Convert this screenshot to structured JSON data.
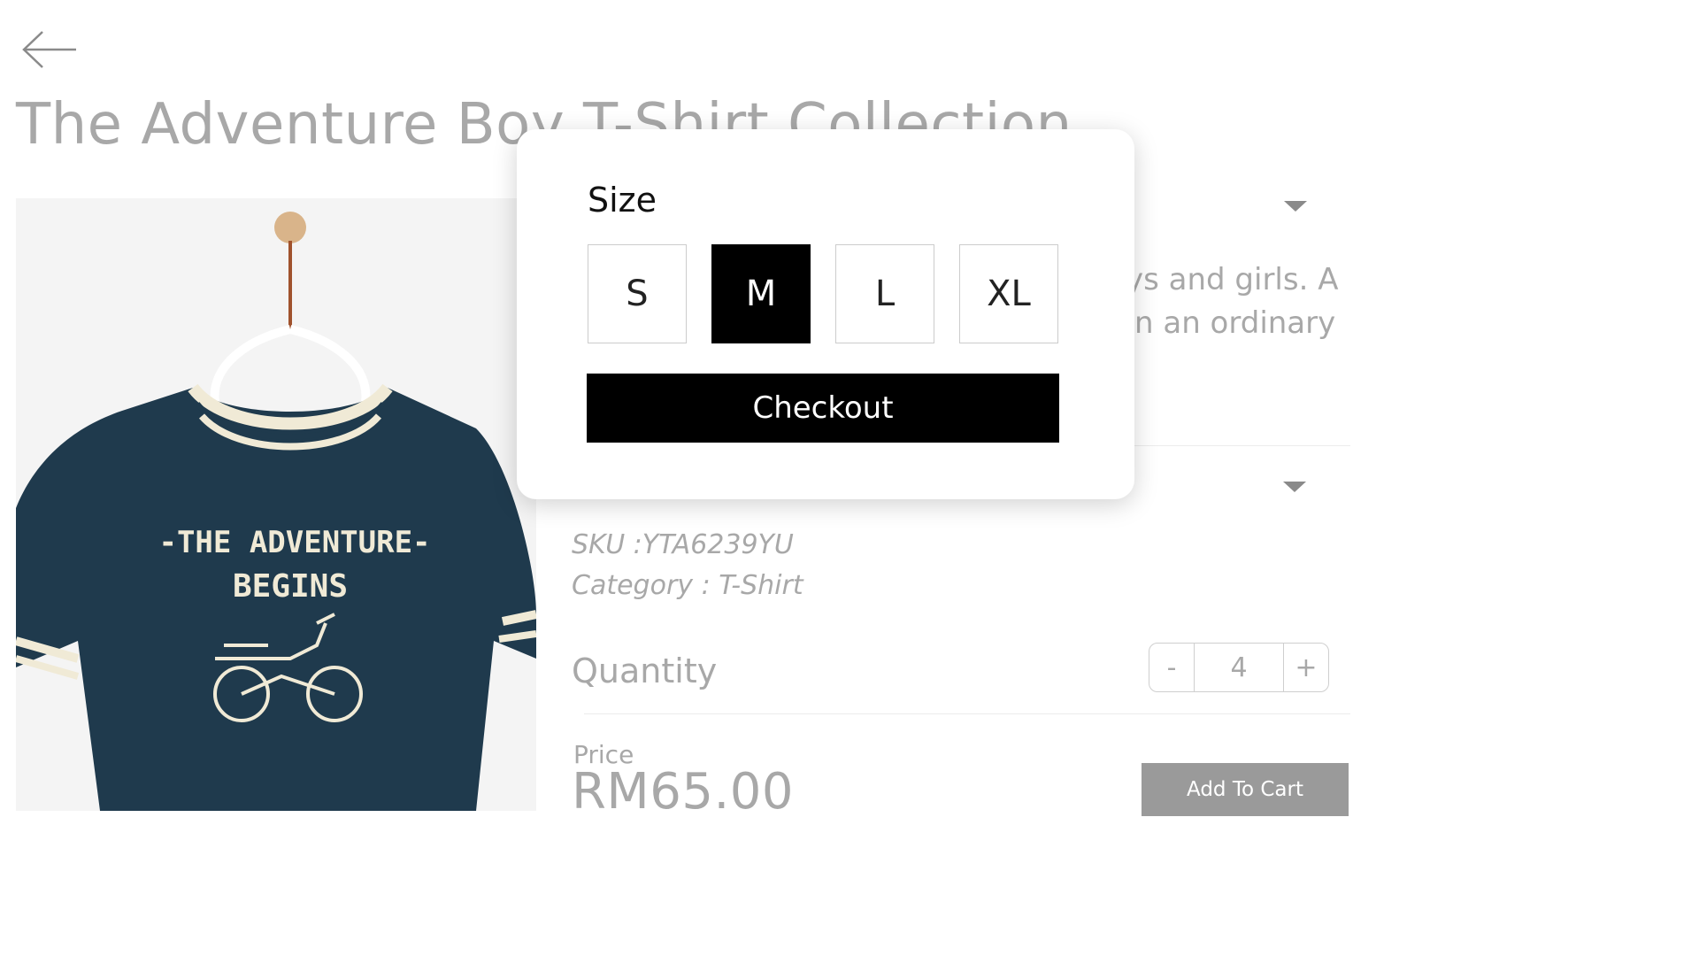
{
  "header": {
    "title": "The Adventure Boy T-Shirt Collection"
  },
  "product": {
    "image_alt": "Navy t-shirt with The Adventure Begins print",
    "print_text_line1": "-THE ADVENTURE-",
    "print_text_line2": "BEGINS",
    "description_line1_fragment": "ys and girls. A",
    "description_line2_fragment": "n an ordinary",
    "sku": "SKU :YTA6239YU",
    "category": "Category : T-Shirt"
  },
  "quantity": {
    "label": "Quantity",
    "minus": "-",
    "value": "4",
    "plus": "+"
  },
  "price": {
    "label": "Price",
    "value": "RM65.00"
  },
  "add_to_cart_label": "Add To Cart",
  "size_popup": {
    "title": "Size",
    "options": [
      "S",
      "M",
      "L",
      "XL"
    ],
    "selected": "M",
    "checkout_label": "Checkout"
  },
  "icons": {
    "back": "arrow-left-icon",
    "dropdown": "caret-down-icon"
  },
  "colors": {
    "shirt": "#1f3a4d",
    "trim": "#f0ead6",
    "muted_text": "#a8a8a8",
    "selected_size": "#000000",
    "add_to_cart_bg": "#9a9a9a"
  }
}
